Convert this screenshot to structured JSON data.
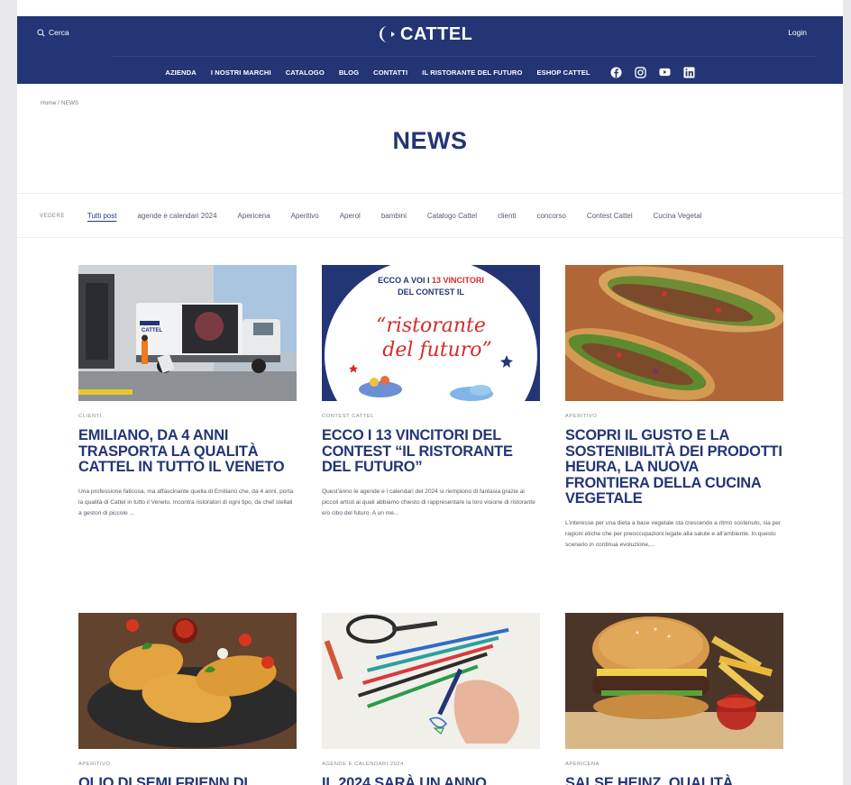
{
  "header": {
    "search_label": "Cerca",
    "logo_text": "CATTEL",
    "login_label": "Login",
    "nav": [
      "AZIENDA",
      "I NOSTRI MARCHI",
      "CATALOGO",
      "BLOG",
      "CONTATTI",
      "IL RISTORANTE DEL FUTURO",
      "ESHOP CATTEL"
    ],
    "social_icons": [
      "facebook-icon",
      "instagram-icon",
      "youtube-icon",
      "linkedin-icon"
    ]
  },
  "breadcrumb": "Home / NEWS",
  "page_title": "NEWS",
  "filter": {
    "label": "VEDERE",
    "chips": [
      "Tutti post",
      "agende e calendari 2024",
      "Apericena",
      "Aperitivo",
      "Aperol",
      "bambini",
      "Catalogo Cattel",
      "clienti",
      "concorso",
      "Contest Cattel",
      "Cucina Vegetal"
    ]
  },
  "posts": [
    {
      "category": "CLIENTI",
      "title": "EMILIANO, DA 4 ANNI TRASPORTA LA QUALITÀ CATTEL IN TUTTO IL VENETO",
      "excerpt": "Una professione faticosa, ma affascinante quella di Emiliano che, da 4 anni, porta la qualità di Cattel in tutto il Veneto. Incontra ristoratori di ogni tipo, da chef stellati a gestori di piccole ...",
      "image_text": "CATTEL"
    },
    {
      "category": "CONTEST CATTEL",
      "title": "ECCO I 13 VINCITORI DEL CONTEST “IL RISTORANTE DEL FUTURO”",
      "excerpt": "Quest'anno le agende e i calendari del 2024 si riempiono di fantasia grazie ai piccoli artisti ai quali abbiamo chiesto di rappresentare la loro visione di ristorante e/o cibo del futuro. A un me...",
      "image_line1_a": "ECCO A VOI I ",
      "image_line1_b": "13 VINCITORI",
      "image_line2": "DEL CONTEST IL",
      "image_script1": "“ristorante",
      "image_script2": "del futuro”"
    },
    {
      "category": "APERITIVO",
      "title": "SCOPRI IL GUSTO E LA SOSTENIBILITÀ DEI PRODOTTI HEURA, LA NUOVA FRONTIERA DELLA CUCINA VEGETALE",
      "excerpt": "L'interesse per una dieta a base vegetale sta crescendo a ritmo sostenuto, sia per ragioni etiche che per preoccupazioni legate alla salute e all'ambiente. In questo scenario in continua evoluzione,..."
    },
    {
      "category": "APERITIVO",
      "title": "OLIO DI SEMI FRIENN DI"
    },
    {
      "category": "AGENDE E CALENDARI 2024",
      "title": "IL 2024 SARÀ UN ANNO"
    },
    {
      "category": "APERICENA",
      "title": "SALSE HEINZ, QUALITÀ"
    }
  ],
  "colors": {
    "brand_navy": "#233575",
    "accent_red": "#d62b2b",
    "background": "#e9e9ec"
  }
}
